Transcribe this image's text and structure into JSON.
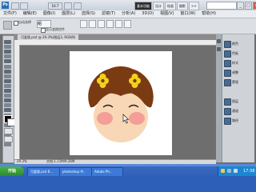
{
  "title_bar": {
    "app_badge": "Ps",
    "zoom": "16.7",
    "workspaces": [
      "基本功能",
      "设计",
      "绘画",
      "摄影",
      ">>"
    ],
    "active_workspace": 0,
    "window_controls": [
      "_",
      "□",
      "×"
    ]
  },
  "menu": [
    "文件(F)",
    "编辑(E)",
    "图像(I)",
    "图层(L)",
    "选择(S)",
    "滤镜(T)",
    "分析(A)",
    "3D(D)",
    "视图(V)",
    "窗口(W)",
    "帮助(H)"
  ],
  "options": {
    "label": "自动选择",
    "select_value": "组",
    "text": "显示变换控件"
  },
  "document": {
    "tab_title": "可爱版.psd @ 29.3%(图层3, RGB/8)",
    "zoom_readout": "29.3%",
    "doc_info": "文档:1.11M/9.26M"
  },
  "panels": {
    "items": [
      "颜色",
      "色板",
      "样式",
      "调整",
      "蒙版",
      "图层",
      "通道",
      "路径"
    ]
  },
  "taskbar": {
    "start_label": "开始",
    "tasks": [
      "可爱版.psd 8...",
      "photoshop 中..",
      "Adobe Ph..."
    ],
    "clock": "17:38"
  },
  "colors": {
    "hair": "#7a3a12",
    "face": "#f7d7b6",
    "blush": "#f29090",
    "flower": "#f2d21a",
    "fg_swatch": "#000000",
    "bg_swatch": "#ffffff"
  },
  "icons": {
    "tools": [
      "move-tool-icon",
      "marquee-tool-icon",
      "lasso-tool-icon",
      "quick-select-icon",
      "crop-tool-icon",
      "eyedropper-icon",
      "healing-brush-icon",
      "brush-tool-icon",
      "clone-stamp-icon",
      "history-brush-icon",
      "eraser-icon",
      "gradient-tool-icon",
      "blur-tool-icon",
      "dodge-tool-icon",
      "pen-tool-icon",
      "type-tool-icon",
      "path-select-icon",
      "shape-tool-icon",
      "3d-rotate-icon",
      "3d-orbit-icon",
      "hand-tool-icon",
      "zoom-tool-icon"
    ]
  }
}
